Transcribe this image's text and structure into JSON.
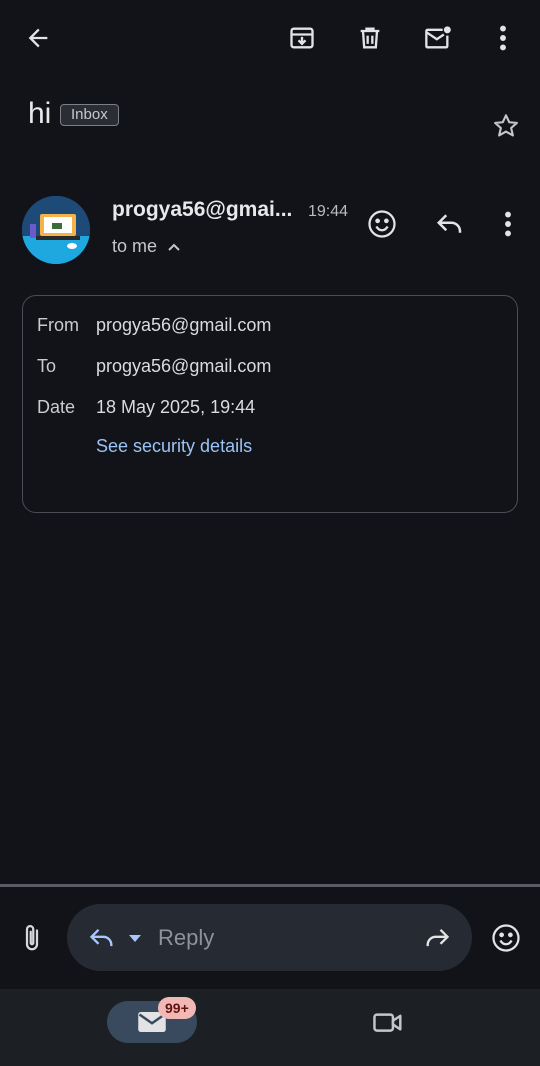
{
  "toolbar": {
    "back": "arrow-left-icon",
    "archive": "archive-icon",
    "delete": "trash-icon",
    "mark_unread": "mail-unread-icon",
    "more": "more-vertical-icon"
  },
  "email": {
    "subject": "hi",
    "label": "Inbox",
    "sender_display": "progya56@gmai...",
    "time": "19:44",
    "recipient_summary": "to me"
  },
  "details": {
    "from_label": "From",
    "from_value": "progya56@gmail.com",
    "to_label": "To",
    "to_value": "progya56@gmail.com",
    "date_label": "Date",
    "date_value": "18 May 2025, 19:44",
    "security_link": "See security details"
  },
  "reply_bar": {
    "placeholder": "Reply"
  },
  "bottom_nav": {
    "mail_badge": "99+"
  },
  "colors": {
    "background": "#111318",
    "link": "#9cc3f5",
    "badge": "#f2b8b5",
    "active_tab": "#3a4a5e"
  }
}
